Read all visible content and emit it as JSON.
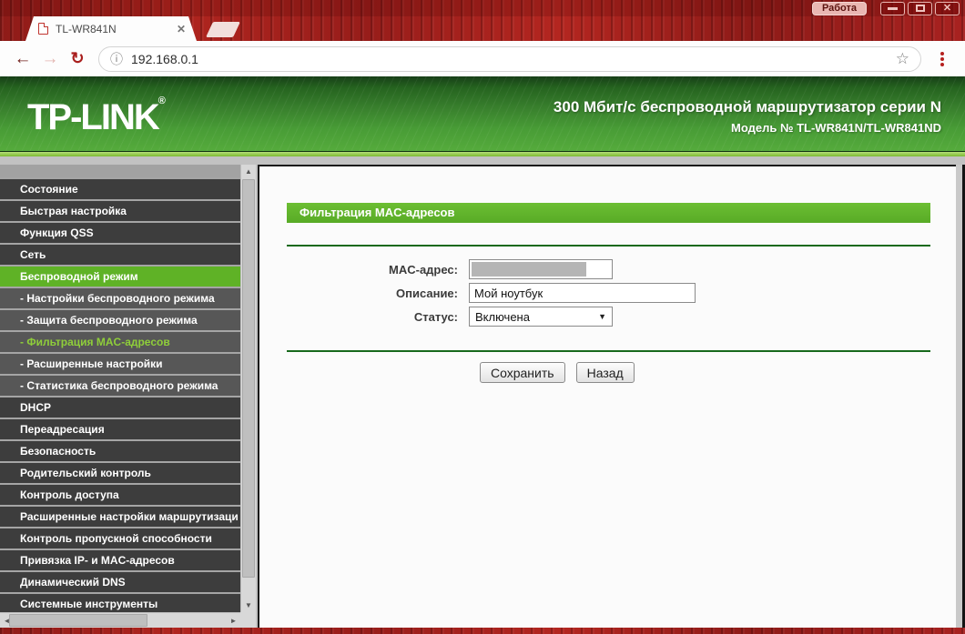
{
  "window": {
    "profile_label": "Работа",
    "tab": {
      "title": "TL-WR841N"
    },
    "address": "192.168.0.1"
  },
  "icons": {
    "back": "←",
    "forward": "→",
    "reload": "↻",
    "info": "ⓘ",
    "star": "☆",
    "tab_close": "✕",
    "window_close": "✕",
    "select_arrow": "▼",
    "scroll_up": "▲",
    "scroll_down": "▼",
    "scroll_left": "◄",
    "scroll_right": "►"
  },
  "header": {
    "logo": "TP-LINK",
    "logo_reg": "®",
    "title": "300 Мбит/с беспроводной маршрутизатор серии N",
    "model": "Модель № TL-WR841N/TL-WR841ND"
  },
  "sidebar": {
    "items": [
      {
        "label": "Состояние",
        "type": "main"
      },
      {
        "label": "Быстрая настройка",
        "type": "main"
      },
      {
        "label": "Функция QSS",
        "type": "main"
      },
      {
        "label": "Сеть",
        "type": "main"
      },
      {
        "label": "Беспроводной режим",
        "type": "main",
        "active": true
      },
      {
        "label": "- Настройки беспроводного режима",
        "type": "sub"
      },
      {
        "label": "- Защита беспроводного режима",
        "type": "sub"
      },
      {
        "label": "- Фильтрация MAC-адресов",
        "type": "sub",
        "active_text": true
      },
      {
        "label": "- Расширенные настройки",
        "type": "sub"
      },
      {
        "label": "- Статистика беспроводного режима",
        "type": "sub"
      },
      {
        "label": "DHCP",
        "type": "main"
      },
      {
        "label": "Переадресация",
        "type": "main"
      },
      {
        "label": "Безопасность",
        "type": "main"
      },
      {
        "label": "Родительский контроль",
        "type": "main"
      },
      {
        "label": "Контроль доступа",
        "type": "main"
      },
      {
        "label": "Расширенные настройки маршрутизаци",
        "type": "main"
      },
      {
        "label": "Контроль пропускной способности",
        "type": "main"
      },
      {
        "label": "Привязка IP- и MAC-адресов",
        "type": "main"
      },
      {
        "label": "Динамический DNS",
        "type": "main"
      },
      {
        "label": "Системные инструменты",
        "type": "main"
      }
    ]
  },
  "content": {
    "section_title": "Фильтрация MAC-адресов",
    "form": {
      "mac_label": "MAC-адрес:",
      "desc_label": "Описание:",
      "desc_value": "Мой ноутбук",
      "status_label": "Статус:",
      "status_value": "Включена"
    },
    "buttons": {
      "save": "Сохранить",
      "back": "Назад"
    }
  },
  "colors": {
    "theme_red": "#a82220",
    "header_green_dark": "#25631f",
    "header_green_light": "#55ab3c",
    "accent_green": "#5fb226",
    "active_link_green": "#8fce3a",
    "hr_green": "#17691c"
  }
}
